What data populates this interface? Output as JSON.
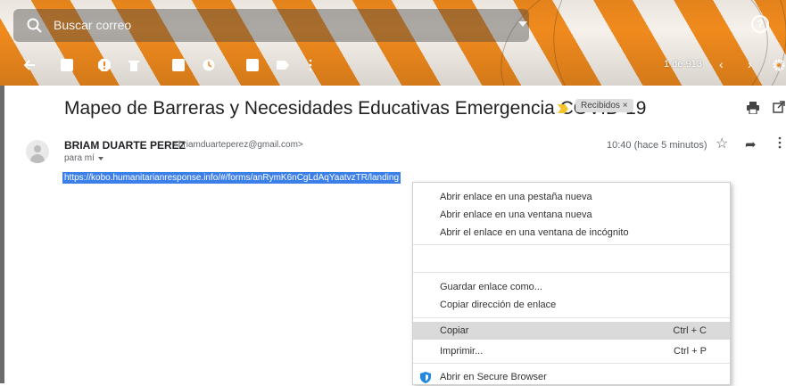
{
  "search": {
    "placeholder": "Buscar correo"
  },
  "toolbar": {
    "counter": "1 de 913",
    "prev": "‹",
    "next": "›"
  },
  "message": {
    "subject": "Mapeo de Barreras y Necesidades Educativas Emergencia COVID-19",
    "label": "Recibidos",
    "label_remove": "×",
    "sender_name": "BRIAM DUARTE PEREZ",
    "sender_email": "<briamduarteperez@gmail.com>",
    "to": "para mí",
    "time": "10:40 (hace 5 minutos)",
    "link": "https://kobo.humanitarianresponse.info/#/forms/anRymK6nCgLdAqYaatvzTR/landing"
  },
  "context_menu": {
    "items": [
      {
        "label": "Abrir enlace en una pestaña nueva",
        "shortcut": ""
      },
      {
        "label": "Abrir enlace en una ventana nueva",
        "shortcut": ""
      },
      {
        "label": "Abrir el enlace en una ventana de incógnito",
        "shortcut": ""
      },
      {
        "label": "Guardar enlace como...",
        "shortcut": ""
      },
      {
        "label": "Copiar dirección de enlace",
        "shortcut": ""
      },
      {
        "label": "Copiar",
        "shortcut": "Ctrl + C"
      },
      {
        "label": "Imprimir...",
        "shortcut": "Ctrl + P"
      },
      {
        "label": "Abrir en Secure Browser",
        "shortcut": ""
      }
    ]
  },
  "colors": {
    "accent_orange": "#f08a1d",
    "selection": "#3d7fe8",
    "important_marker": "#f4c430"
  }
}
